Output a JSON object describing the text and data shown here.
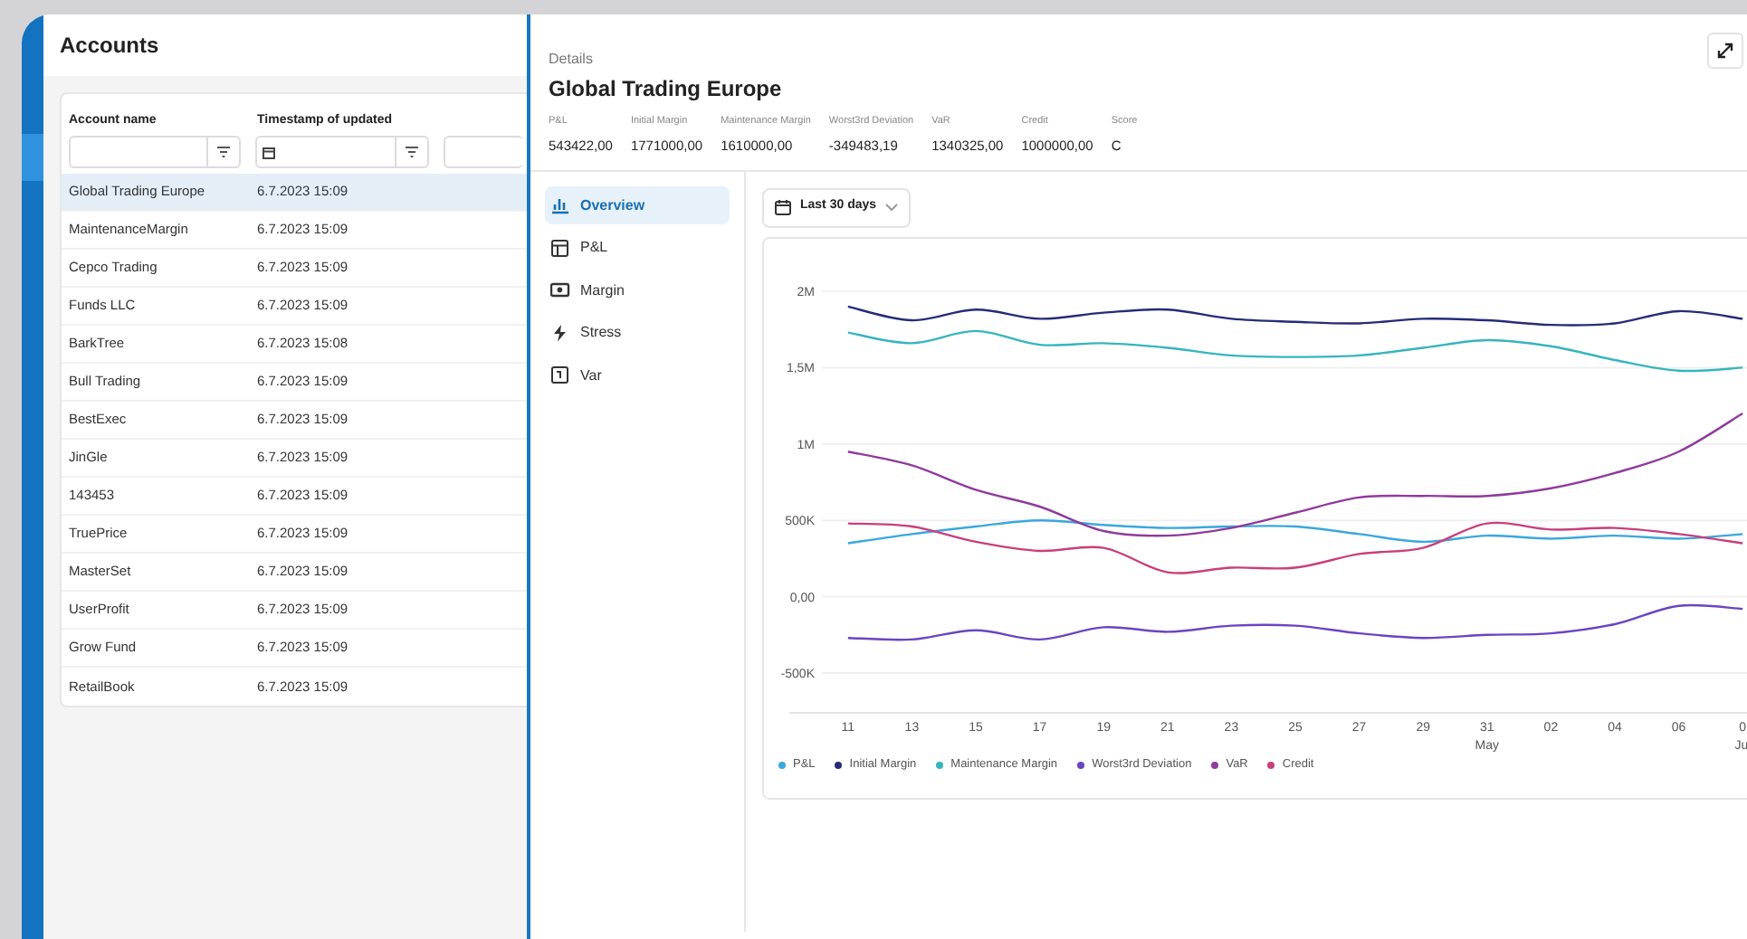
{
  "accounts": {
    "title": "Accounts",
    "table": {
      "columns": [
        "Account name",
        "Timestamp of updated"
      ],
      "rows": [
        {
          "cells": [
            "Global Trading Europe",
            "6.7.2023 15:09"
          ],
          "selected": true
        },
        {
          "cells": [
            "MaintenanceMargin",
            "6.7.2023 15:09"
          ],
          "selected": false
        },
        {
          "cells": [
            "Cepco Trading",
            "6.7.2023 15:09"
          ],
          "selected": false
        },
        {
          "cells": [
            "Funds LLC",
            "6.7.2023 15:09"
          ],
          "selected": false
        },
        {
          "cells": [
            "BarkTree",
            "6.7.2023 15:08"
          ],
          "selected": false
        },
        {
          "cells": [
            "Bull Trading",
            "6.7.2023 15:09"
          ],
          "selected": false
        },
        {
          "cells": [
            "BestExec",
            "6.7.2023 15:09"
          ],
          "selected": false
        },
        {
          "cells": [
            "JinGle",
            "6.7.2023 15:09"
          ],
          "selected": false
        },
        {
          "cells": [
            "143453",
            "6.7.2023 15:09"
          ],
          "selected": false
        },
        {
          "cells": [
            "TruePrice",
            "6.7.2023 15:09"
          ],
          "selected": false
        },
        {
          "cells": [
            "MasterSet",
            "6.7.2023 15:09"
          ],
          "selected": false
        },
        {
          "cells": [
            "UserProfit",
            "6.7.2023 15:09"
          ],
          "selected": false
        },
        {
          "cells": [
            "Grow Fund",
            "6.7.2023 15:09"
          ],
          "selected": false
        },
        {
          "cells": [
            "RetailBook",
            "6.7.2023 15:09"
          ],
          "selected": false
        }
      ]
    }
  },
  "details": {
    "breadcrumb": "Details",
    "title": "Global Trading Europe",
    "metrics": [
      {
        "label": "P&L",
        "value": "543422,00"
      },
      {
        "label": "Initial Margin",
        "value": "1771000,00"
      },
      {
        "label": "Maintenance Margin",
        "value": "1610000,00"
      },
      {
        "label": "Worst3rd Deviation",
        "value": "-349483,19"
      },
      {
        "label": "VaR",
        "value": "1340325,00"
      },
      {
        "label": "Credit",
        "value": "1000000,00"
      },
      {
        "label": "Score",
        "value": "C"
      }
    ],
    "nav": [
      {
        "label": "Overview",
        "selected": true
      },
      {
        "label": "P&L",
        "selected": false
      },
      {
        "label": "Margin",
        "selected": false
      },
      {
        "label": "Stress",
        "selected": false
      },
      {
        "label": "Var",
        "selected": false
      }
    ],
    "date_range": "Last 30 days",
    "chart_data": {
      "type": "line",
      "categories": [
        "11",
        "13",
        "15",
        "17",
        "19",
        "21",
        "23",
        "25",
        "27",
        "29",
        "31",
        "02",
        "04",
        "06",
        "0"
      ],
      "yticks": [
        {
          "value": -500000,
          "label": "-500K"
        },
        {
          "value": 0,
          "label": "0,00"
        },
        {
          "value": 500000,
          "label": "500K"
        },
        {
          "value": 1000000,
          "label": "1M"
        },
        {
          "value": 1500000,
          "label": "1,5M"
        },
        {
          "value": 2000000,
          "label": "2M"
        }
      ],
      "ylim": [
        -500000,
        2000000
      ],
      "grid": true,
      "legend": "bottom",
      "annotations": [
        "May",
        "Ju"
      ],
      "series": [
        {
          "name": "P&L",
          "color": "#3ba7dd",
          "values": [
            350000,
            410000,
            460000,
            500000,
            470000,
            450000,
            460000,
            460000,
            410000,
            360000,
            400000,
            380000,
            400000,
            380000,
            410000
          ]
        },
        {
          "name": "Initial Margin",
          "color": "#262c78",
          "values": [
            1900000,
            1810000,
            1880000,
            1820000,
            1860000,
            1880000,
            1820000,
            1800000,
            1790000,
            1820000,
            1810000,
            1780000,
            1790000,
            1870000,
            1820000
          ]
        },
        {
          "name": "Maintenance Margin",
          "color": "#36b5bd",
          "values": [
            1730000,
            1660000,
            1740000,
            1650000,
            1660000,
            1630000,
            1580000,
            1570000,
            1580000,
            1630000,
            1680000,
            1640000,
            1550000,
            1480000,
            1500000
          ]
        },
        {
          "name": "Worst3rd Deviation",
          "color": "#6a45c0",
          "values": [
            -270000,
            -280000,
            -220000,
            -280000,
            -200000,
            -230000,
            -190000,
            -190000,
            -240000,
            -270000,
            -250000,
            -240000,
            -180000,
            -60000,
            -80000
          ]
        },
        {
          "name": "VaR",
          "color": "#8f3b9c",
          "values": [
            950000,
            860000,
            700000,
            590000,
            430000,
            400000,
            450000,
            550000,
            650000,
            660000,
            660000,
            710000,
            810000,
            950000,
            1200000
          ]
        },
        {
          "name": "Credit",
          "color": "#c93f7b",
          "values": [
            480000,
            460000,
            360000,
            300000,
            320000,
            160000,
            190000,
            190000,
            280000,
            320000,
            480000,
            440000,
            450000,
            410000,
            350000
          ]
        }
      ]
    }
  }
}
